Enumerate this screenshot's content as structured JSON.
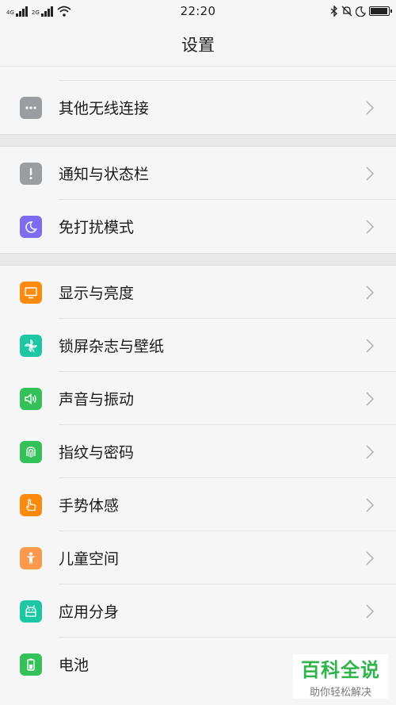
{
  "status_bar": {
    "time": "22:20",
    "sim1_label": "4G",
    "sim2_label": "2G",
    "battery_level": 0.95
  },
  "header": {
    "title": "设置"
  },
  "sections": [
    {
      "items": [
        {
          "label": "其他无线连接",
          "icon": "more-dots-icon",
          "color": "#9a9ea3"
        }
      ]
    },
    {
      "items": [
        {
          "label": "通知与状态栏",
          "icon": "exclamation-icon",
          "color": "#9a9ea3"
        },
        {
          "label": "免打扰模式",
          "icon": "moon-icon",
          "color": "#7b6cf0"
        }
      ]
    },
    {
      "items": [
        {
          "label": "显示与亮度",
          "icon": "monitor-icon",
          "color": "#fb8a0f"
        },
        {
          "label": "锁屏杂志与壁纸",
          "icon": "pinwheel-icon",
          "color": "#1dc7a4"
        },
        {
          "label": "声音与振动",
          "icon": "speaker-icon",
          "color": "#35c15a"
        },
        {
          "label": "指纹与密码",
          "icon": "fingerprint-icon",
          "color": "#35c15a"
        },
        {
          "label": "手势体感",
          "icon": "hand-gesture-icon",
          "color": "#fb8a0f"
        },
        {
          "label": "儿童空间",
          "icon": "child-icon",
          "color": "#fb9a4c"
        },
        {
          "label": "应用分身",
          "icon": "app-clone-icon",
          "color": "#1dc7a4"
        },
        {
          "label": "电池",
          "icon": "battery-icon",
          "color": "#35c15a"
        }
      ]
    }
  ],
  "watermark": {
    "title": "百科全说",
    "subtitle": "助你轻松解决"
  }
}
